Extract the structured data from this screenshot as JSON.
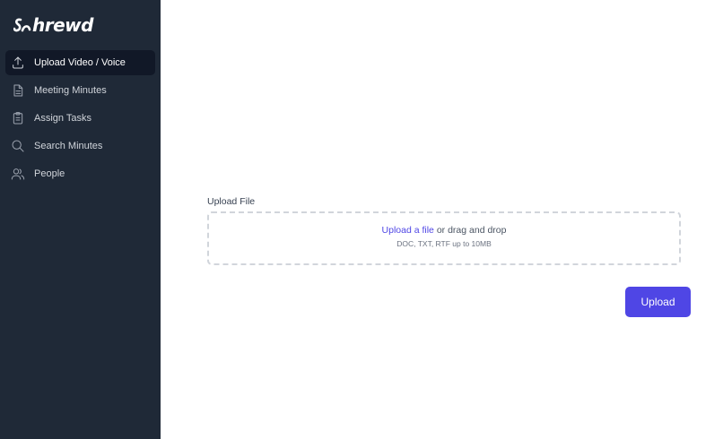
{
  "brand": {
    "name": "hrewd"
  },
  "sidebar": {
    "items": [
      {
        "label": "Upload Video / Voice",
        "icon": "upload-icon",
        "active": true
      },
      {
        "label": "Meeting Minutes",
        "icon": "document-icon",
        "active": false
      },
      {
        "label": "Assign Tasks",
        "icon": "clipboard-icon",
        "active": false
      },
      {
        "label": "Search Minutes",
        "icon": "search-icon",
        "active": false
      },
      {
        "label": "People",
        "icon": "users-icon",
        "active": false
      }
    ]
  },
  "upload": {
    "label": "Upload File",
    "link_text": "Upload a file",
    "drag_text": "or drag and drop",
    "hint": "DOC, TXT, RTF up to 10MB",
    "button_label": "Upload"
  },
  "colors": {
    "sidebar_bg": "#1f2937",
    "active_bg": "#111827",
    "accent": "#4f46e5"
  }
}
